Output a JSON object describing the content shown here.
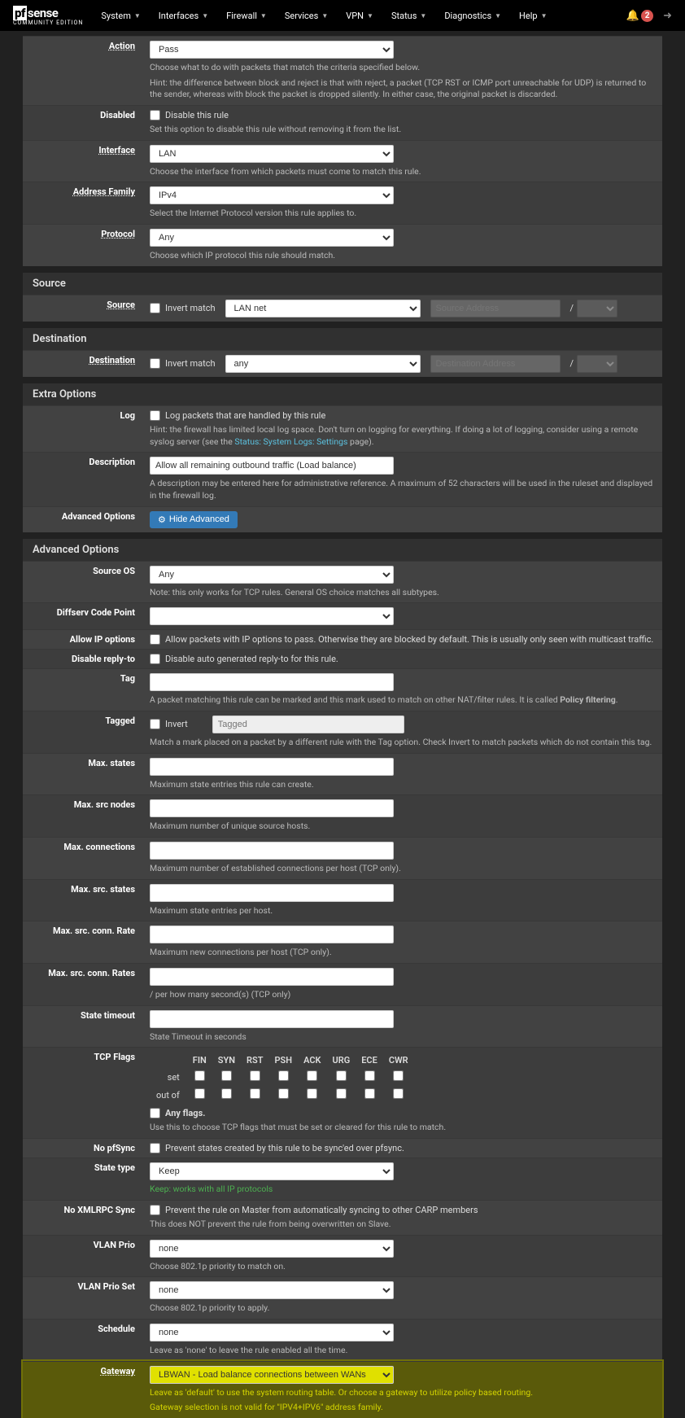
{
  "brand": {
    "main_pf": "pf",
    "main_sense": "sense",
    "sub": "COMMUNITY EDITION"
  },
  "nav": {
    "items": [
      "System",
      "Interfaces",
      "Firewall",
      "Services",
      "VPN",
      "Status",
      "Diagnostics",
      "Help"
    ],
    "notif_count": "2"
  },
  "groups": {
    "action": {
      "label": "Action",
      "value": "Pass",
      "help1": "Choose what to do with packets that match the criteria specified below.",
      "help2": "Hint: the difference between block and reject is that with reject, a packet (TCP RST or ICMP port unreachable for UDP) is returned to the sender, whereas with block the packet is dropped silently. In either case, the original packet is discarded."
    },
    "disabled": {
      "label": "Disabled",
      "chk": "Disable this rule",
      "help": "Set this option to disable this rule without removing it from the list."
    },
    "interface": {
      "label": "Interface",
      "value": "LAN",
      "help": "Choose the interface from which packets must come to match this rule."
    },
    "afam": {
      "label": "Address Family",
      "value": "IPv4",
      "help": "Select the Internet Protocol version this rule applies to."
    },
    "protocol": {
      "label": "Protocol",
      "value": "Any",
      "help": "Choose which IP protocol this rule should match."
    }
  },
  "source": {
    "heading": "Source",
    "label": "Source",
    "invert": "Invert match",
    "net": "LAN net",
    "addr_ph": "Source Address",
    "slash": "/"
  },
  "dest": {
    "heading": "Destination",
    "label": "Destination",
    "invert": "Invert match",
    "net": "any",
    "addr_ph": "Destination Address",
    "slash": "/"
  },
  "extra": {
    "heading": "Extra Options",
    "log": {
      "label": "Log",
      "chk": "Log packets that are handled by this rule",
      "help_a": "Hint: the firewall has limited local log space. Don't turn on logging for everything. If doing a lot of logging, consider using a remote syslog server (see the ",
      "help_link": "Status: System Logs: Settings",
      "help_b": " page)."
    },
    "desc": {
      "label": "Description",
      "value": "Allow all remaining outbound traffic (Load balance)",
      "help": "A description may be entered here for administrative reference. A maximum of 52 characters will be used in the ruleset and displayed in the firewall log."
    },
    "adv_btn": {
      "label": "Advanced Options",
      "btn": "Hide Advanced"
    }
  },
  "adv": {
    "heading": "Advanced Options",
    "source_os": {
      "label": "Source OS",
      "value": "Any",
      "help": "Note: this only works for TCP rules. General OS choice matches all subtypes."
    },
    "diffserv": {
      "label": "Diffserv Code Point",
      "value": ""
    },
    "allow_ip": {
      "label": "Allow IP options",
      "chk": "Allow packets with IP options to pass. Otherwise they are blocked by default. This is usually only seen with multicast traffic."
    },
    "reply_to": {
      "label": "Disable reply-to",
      "chk": "Disable auto generated reply-to for this rule."
    },
    "tag": {
      "label": "Tag",
      "help_a": "A packet matching this rule can be marked and this mark used to match on other NAT/filter rules. It is called ",
      "help_b": "Policy filtering",
      "help_c": "."
    },
    "tagged": {
      "label": "Tagged",
      "invert": "Invert",
      "ph": "Tagged",
      "help": "Match a mark placed on a packet by a different rule with the Tag option. Check Invert to match packets which do not contain this tag."
    },
    "max_states": {
      "label": "Max. states",
      "help": "Maximum state entries this rule can create."
    },
    "max_src_nodes": {
      "label": "Max. src nodes",
      "help": "Maximum number of unique source hosts."
    },
    "max_conn": {
      "label": "Max. connections",
      "help": "Maximum number of established connections per host (TCP only)."
    },
    "max_src_states": {
      "label": "Max. src. states",
      "help": "Maximum state entries per host."
    },
    "max_src_rate": {
      "label": "Max. src. conn. Rate",
      "help": "Maximum new connections per host (TCP only)."
    },
    "max_src_rates": {
      "label": "Max. src. conn. Rates",
      "help": "/ per how many second(s) (TCP only)"
    },
    "state_timeout": {
      "label": "State timeout",
      "help": "State Timeout in seconds"
    },
    "tcp_flags": {
      "label": "TCP Flags",
      "cols": [
        "FIN",
        "SYN",
        "RST",
        "PSH",
        "ACK",
        "URG",
        "ECE",
        "CWR"
      ],
      "rows": [
        "set",
        "out of"
      ],
      "any": "Any flags.",
      "help": "Use this to choose TCP flags that must be set or cleared for this rule to match."
    },
    "no_pfsync": {
      "label": "No pfSync",
      "chk": "Prevent states created by this rule to be sync'ed over pfsync."
    },
    "state_type": {
      "label": "State type",
      "value": "Keep",
      "help": "Keep: works with all IP protocols"
    },
    "no_xmlrpc": {
      "label": "No XMLRPC Sync",
      "chk": "Prevent the rule on Master from automatically syncing to other CARP members",
      "help": "This does NOT prevent the rule from being overwritten on Slave."
    },
    "vlan_prio": {
      "label": "VLAN Prio",
      "value": "none",
      "help": "Choose 802.1p priority to match on."
    },
    "vlan_prio_set": {
      "label": "VLAN Prio Set",
      "value": "none",
      "help": "Choose 802.1p priority to apply."
    },
    "schedule": {
      "label": "Schedule",
      "value": "none",
      "help": "Leave as 'none' to leave the rule enabled all the time."
    },
    "gateway": {
      "label": "Gateway",
      "value": "LBWAN - Load balance connections between WANs",
      "help1": "Leave as 'default' to use the system routing table. Or choose a gateway to utilize policy based routing.",
      "help2": "Gateway selection is not valid for \"IPV4+IPV6\" address family."
    }
  }
}
